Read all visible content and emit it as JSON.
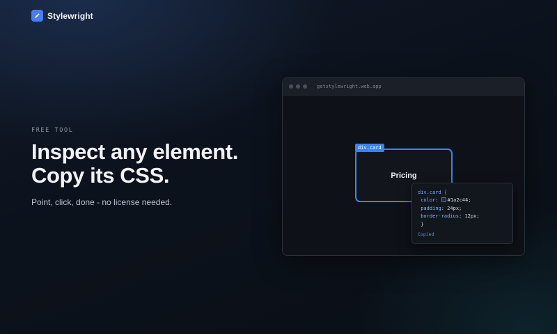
{
  "brand": {
    "name": "Stylewright",
    "logo_icon": "pen-icon",
    "logo_color": "#4b7bf5"
  },
  "hero": {
    "eyebrow": "FREE TOOL",
    "headline_line1": "Inspect any element.",
    "headline_line2": "Copy its CSS.",
    "subline": "Point, click, done - no license needed."
  },
  "preview": {
    "url": "getstylewright.web.app",
    "target_label": "div.card",
    "target_text": "Pricing",
    "accent_color": "#3b82f6",
    "code": {
      "open": "div.card {",
      "color_prop": "color",
      "color_value": "#1a2c44;",
      "padding_prop": "padding",
      "padding_value": "24px;",
      "radius_prop": "border-radius",
      "radius_value": "12px;",
      "close": "}"
    },
    "status": "Copied"
  }
}
